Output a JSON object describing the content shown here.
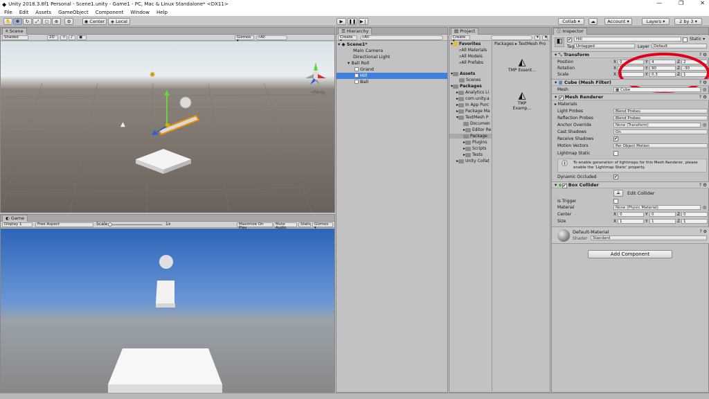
{
  "window": {
    "title": "Unity 2018.3.8f1 Personal - Scene1.unity - Game1 - PC, Mac & Linux Standalone* <DX11>",
    "min": "—",
    "max": "❐",
    "close": "✕"
  },
  "menu": [
    "File",
    "Edit",
    "Assets",
    "GameObject",
    "Component",
    "Window",
    "Help"
  ],
  "toolbar": {
    "center": "Center",
    "local": "Local",
    "collab": "Collab ▾",
    "account": "Account ▾",
    "layers": "Layers ▾",
    "layout": "2 by 3 ▾",
    "cloud": "☁"
  },
  "scene": {
    "tab": "Scene",
    "shading": "Shaded",
    "mode2d": "2D",
    "gizmos": "Gizmos ▾",
    "search": "All",
    "persp": "≺Persp",
    "colors": {
      "sky": "#e8ecef",
      "ground": "#6e665e",
      "platform": "#f2f2f2"
    }
  },
  "game": {
    "tab": "Game",
    "display": "Display 1",
    "aspect": "Free Aspect",
    "scale_label": "Scale",
    "scale_value": "1x",
    "maximize": "Maximize On Play",
    "mute": "Mute Audio",
    "stats": "Stats",
    "gizmos": "Gizmos ▾",
    "colors": {
      "sky": "#4d7ec8",
      "ground": "#8d8d8d"
    }
  },
  "hierarchy": {
    "tab": "Hierarchy",
    "create": "Create ▾",
    "search": "All",
    "items": [
      {
        "label": "Scene1*",
        "depth": 0,
        "selected": false,
        "bold": true
      },
      {
        "label": "Main Camera",
        "depth": 1,
        "selected": false
      },
      {
        "label": "Directional Light",
        "depth": 1,
        "selected": false
      },
      {
        "label": "Ball Roll",
        "depth": 1,
        "selected": false
      },
      {
        "label": "Grand",
        "depth": 2,
        "selected": false
      },
      {
        "label": "Hill",
        "depth": 2,
        "selected": true
      },
      {
        "label": "Ball",
        "depth": 2,
        "selected": false
      }
    ]
  },
  "project": {
    "tab": "Project",
    "create": "Create ▾",
    "breadcrumb": [
      "Packages",
      "TextMesh Pro"
    ],
    "favorites": [
      "Favorites",
      "All Materials",
      "All Models",
      "All Prefabs"
    ],
    "assets": [
      "Assets",
      "Scenes"
    ],
    "packages": [
      "Packages",
      "Analytics Li",
      "com.unity.a",
      "In App Purc",
      "Package Ma",
      "TextMesh P",
      "Documen",
      "Editor Re",
      "Package",
      "Plugins",
      "Scripts",
      "Tests",
      "Unity Collat"
    ],
    "files": [
      "TMP Essent...",
      "TMP Examp..."
    ]
  },
  "inspector": {
    "tab": "Inspector",
    "object_name": "Hill",
    "static": "Static ▾",
    "tag_label": "Tag",
    "tag": "Untagged",
    "layer_label": "Layer",
    "layer": "Default",
    "transform": {
      "title": "Transform",
      "position_label": "Position",
      "position": [
        "0",
        "4",
        "2"
      ],
      "rotation_label": "Rotation",
      "rotation": [
        "1",
        "90",
        "-30"
      ],
      "scale_label": "Scale",
      "scale": [
        "4",
        "0.3",
        "1"
      ],
      "axes": [
        "X",
        "Y",
        "Z"
      ]
    },
    "mesh_filter": {
      "title": "Cube (Mesh Filter)",
      "mesh_label": "Mesh",
      "mesh": "Cube"
    },
    "mesh_renderer": {
      "title": "Mesh Renderer",
      "materials": "Materials",
      "rows": [
        {
          "label": "Light Probes",
          "value": "Blend Probes",
          "type": "drop"
        },
        {
          "label": "Reflection Probes",
          "value": "Blend Probes",
          "type": "drop"
        },
        {
          "label": "Anchor Override",
          "value": "None (Transform)",
          "type": "field"
        },
        {
          "label": "Cast Shadows",
          "value": "On",
          "type": "drop"
        },
        {
          "label": "Receive Shadows",
          "value": "✔",
          "type": "check"
        },
        {
          "label": "Motion Vectors",
          "value": "Per Object Motion",
          "type": "drop"
        }
      ],
      "lightmap_static": "Lightmap Static",
      "info": "To enable generation of lightmaps for this Mesh Renderer, please enable the 'Lightmap Static' property.",
      "dynamic_occluded": "Dynamic Occluded"
    },
    "box_collider": {
      "title": "Box Collider",
      "edit": "Edit Collider",
      "is_trigger": "Is Trigger",
      "material_label": "Material",
      "material": "None (Physic Material)",
      "center_label": "Center",
      "center": [
        "0",
        "0",
        "0"
      ],
      "size_label": "Size",
      "size": [
        "1",
        "1",
        "1"
      ]
    },
    "material": {
      "name": "Default-Material",
      "shader_label": "Shader",
      "shader": "Standard"
    },
    "add_component": "Add Component",
    "highlight_color": "#e0001a"
  }
}
